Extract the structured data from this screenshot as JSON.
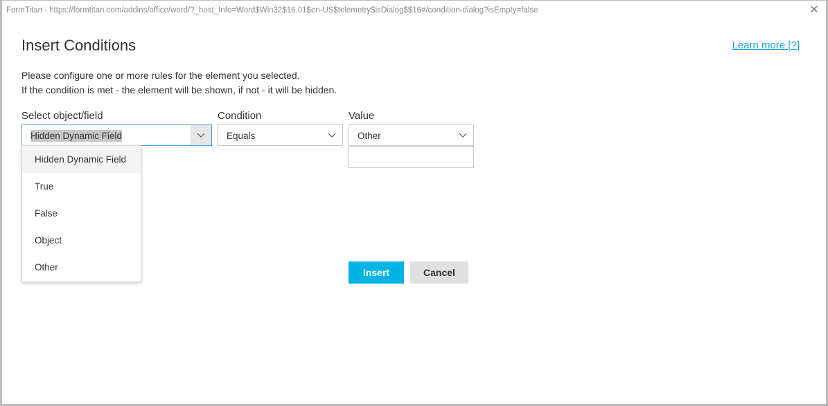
{
  "window": {
    "title": "FormTitan - https://formtitan.com/addins/office/word/?_host_Info=Word$Win32$16.01$en-US$telemetry$isDialog$$16#/condition-dialog?isEmpty=false",
    "close_glyph": "✕"
  },
  "header": {
    "title": "Insert Conditions",
    "learn_more": "Learn more [?]"
  },
  "intro": {
    "line1": "Please configure one or more rules for the element you selected.",
    "line2": "If the condition is met - the element will be shown, if not - it will be hidden."
  },
  "fields": {
    "object": {
      "label": "Select object/field",
      "value": "Hidden Dynamic Field"
    },
    "condition": {
      "label": "Condition",
      "value": "Equals"
    },
    "value": {
      "label": "Value",
      "selected": "Other",
      "input_value": ""
    }
  },
  "dropdown": {
    "items": [
      "Hidden Dynamic Field",
      "True",
      "False",
      "Object",
      "Other"
    ]
  },
  "buttons": {
    "insert": "Insert",
    "cancel": "Cancel"
  },
  "colors": {
    "accent": "#02b4e6",
    "link": "#1aa4cf",
    "focus_border": "#4d9fd6"
  }
}
